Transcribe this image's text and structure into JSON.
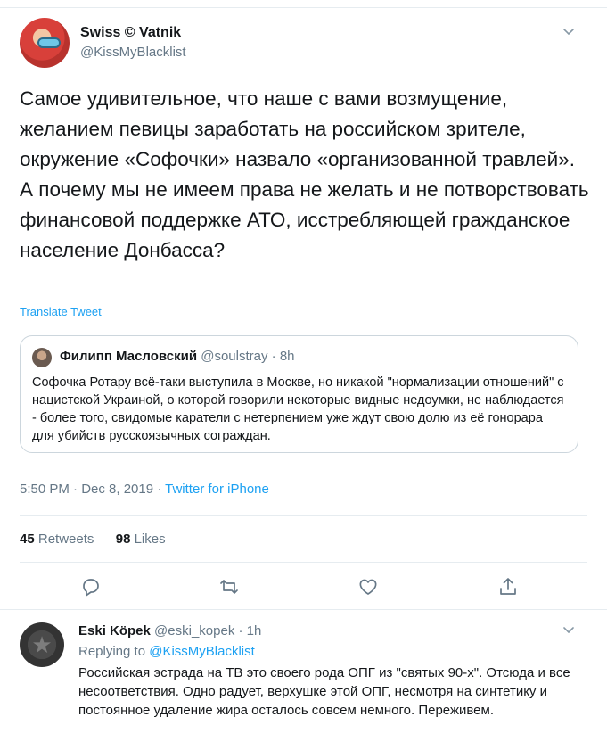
{
  "tweet": {
    "author_name": "Swiss © Vatnik",
    "author_handle": "@KissMyBlacklist",
    "text": "Самое удивительное, что наше с вами возмущение, желанием певицы заработать на российском зрителе, окружение «Софочки» назвало «организованной травлей». А почему мы не имеем права не желать и не потворствовать финансовой поддержке АТО, исстребляющей гражданское население Донбасса?",
    "translate_label": "Translate Tweet",
    "time": "5:50 PM · Dec 8, 2019 · ",
    "source": "Twitter for iPhone",
    "retweets_count": "45",
    "retweets_label": "Retweets",
    "likes_count": "98",
    "likes_label": "Likes"
  },
  "quote": {
    "author_name": "Филипп Масловский",
    "author_handle": "@soulstray",
    "time": "· 8h",
    "text": "Софочка Ротару всё-таки выступила в Москве, но никакой \"нормализации отношений\" с нацистской Украиной, о которой говорили некоторые видные недоумки, не наблюдается - более того, свидомые каратели с нетерпением уже ждут свою долю из её гонорара для убийств русскоязычных сограждан."
  },
  "reply": {
    "author_name": "Eski Köpek",
    "author_handle": "@eski_kopek",
    "time": "· 1h",
    "replying_label": "Replying to ",
    "replying_to": "@KissMyBlacklist",
    "text": "Российская эстрада на ТВ это своего рода ОПГ из \"святых 90-х\". Отсюда и все несоответствия. Одно радует, верхушке этой ОПГ, несмотря на синтетику и постоянное удаление жира осталось совсем немного. Переживем."
  },
  "icons": {
    "reply": "reply-icon",
    "retweet": "retweet-icon",
    "like": "heart-icon",
    "share": "share-icon",
    "menu": "chevron-down-icon"
  },
  "colors": {
    "accent": "#1da1f2",
    "secondary_text": "#657786",
    "divider": "#e6ecf0"
  }
}
